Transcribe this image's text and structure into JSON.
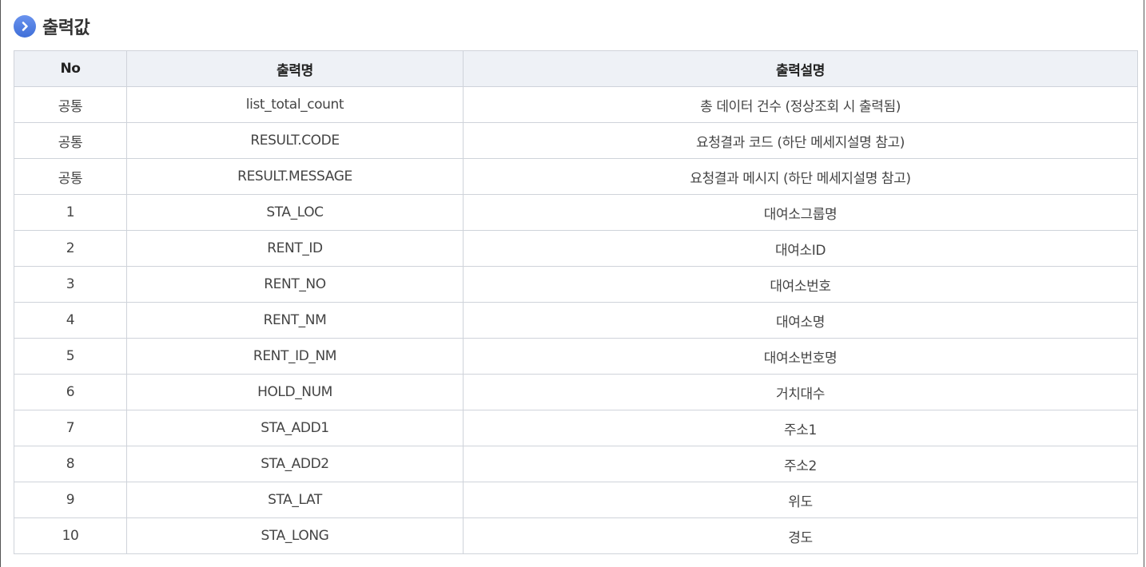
{
  "section": {
    "title": "출력값",
    "icon": "chevron-right-circle-icon",
    "icon_color": "#4a7ae0"
  },
  "table": {
    "headers": [
      "No",
      "출력명",
      "출력설명"
    ],
    "rows": [
      {
        "no": "공통",
        "name": "list_total_count",
        "desc": "총 데이터 건수 (정상조회 시 출력됨)"
      },
      {
        "no": "공통",
        "name": "RESULT.CODE",
        "desc": "요청결과 코드 (하단 메세지설명 참고)"
      },
      {
        "no": "공통",
        "name": "RESULT.MESSAGE",
        "desc": "요청결과 메시지 (하단 메세지설명 참고)"
      },
      {
        "no": "1",
        "name": "STA_LOC",
        "desc": "대여소그룹명"
      },
      {
        "no": "2",
        "name": "RENT_ID",
        "desc": "대여소ID"
      },
      {
        "no": "3",
        "name": "RENT_NO",
        "desc": "대여소번호"
      },
      {
        "no": "4",
        "name": "RENT_NM",
        "desc": "대여소명"
      },
      {
        "no": "5",
        "name": "RENT_ID_NM",
        "desc": "대여소번호명"
      },
      {
        "no": "6",
        "name": "HOLD_NUM",
        "desc": "거치대수"
      },
      {
        "no": "7",
        "name": "STA_ADD1",
        "desc": "주소1"
      },
      {
        "no": "8",
        "name": "STA_ADD2",
        "desc": "주소2"
      },
      {
        "no": "9",
        "name": "STA_LAT",
        "desc": "위도"
      },
      {
        "no": "10",
        "name": "STA_LONG",
        "desc": "경도"
      }
    ]
  }
}
